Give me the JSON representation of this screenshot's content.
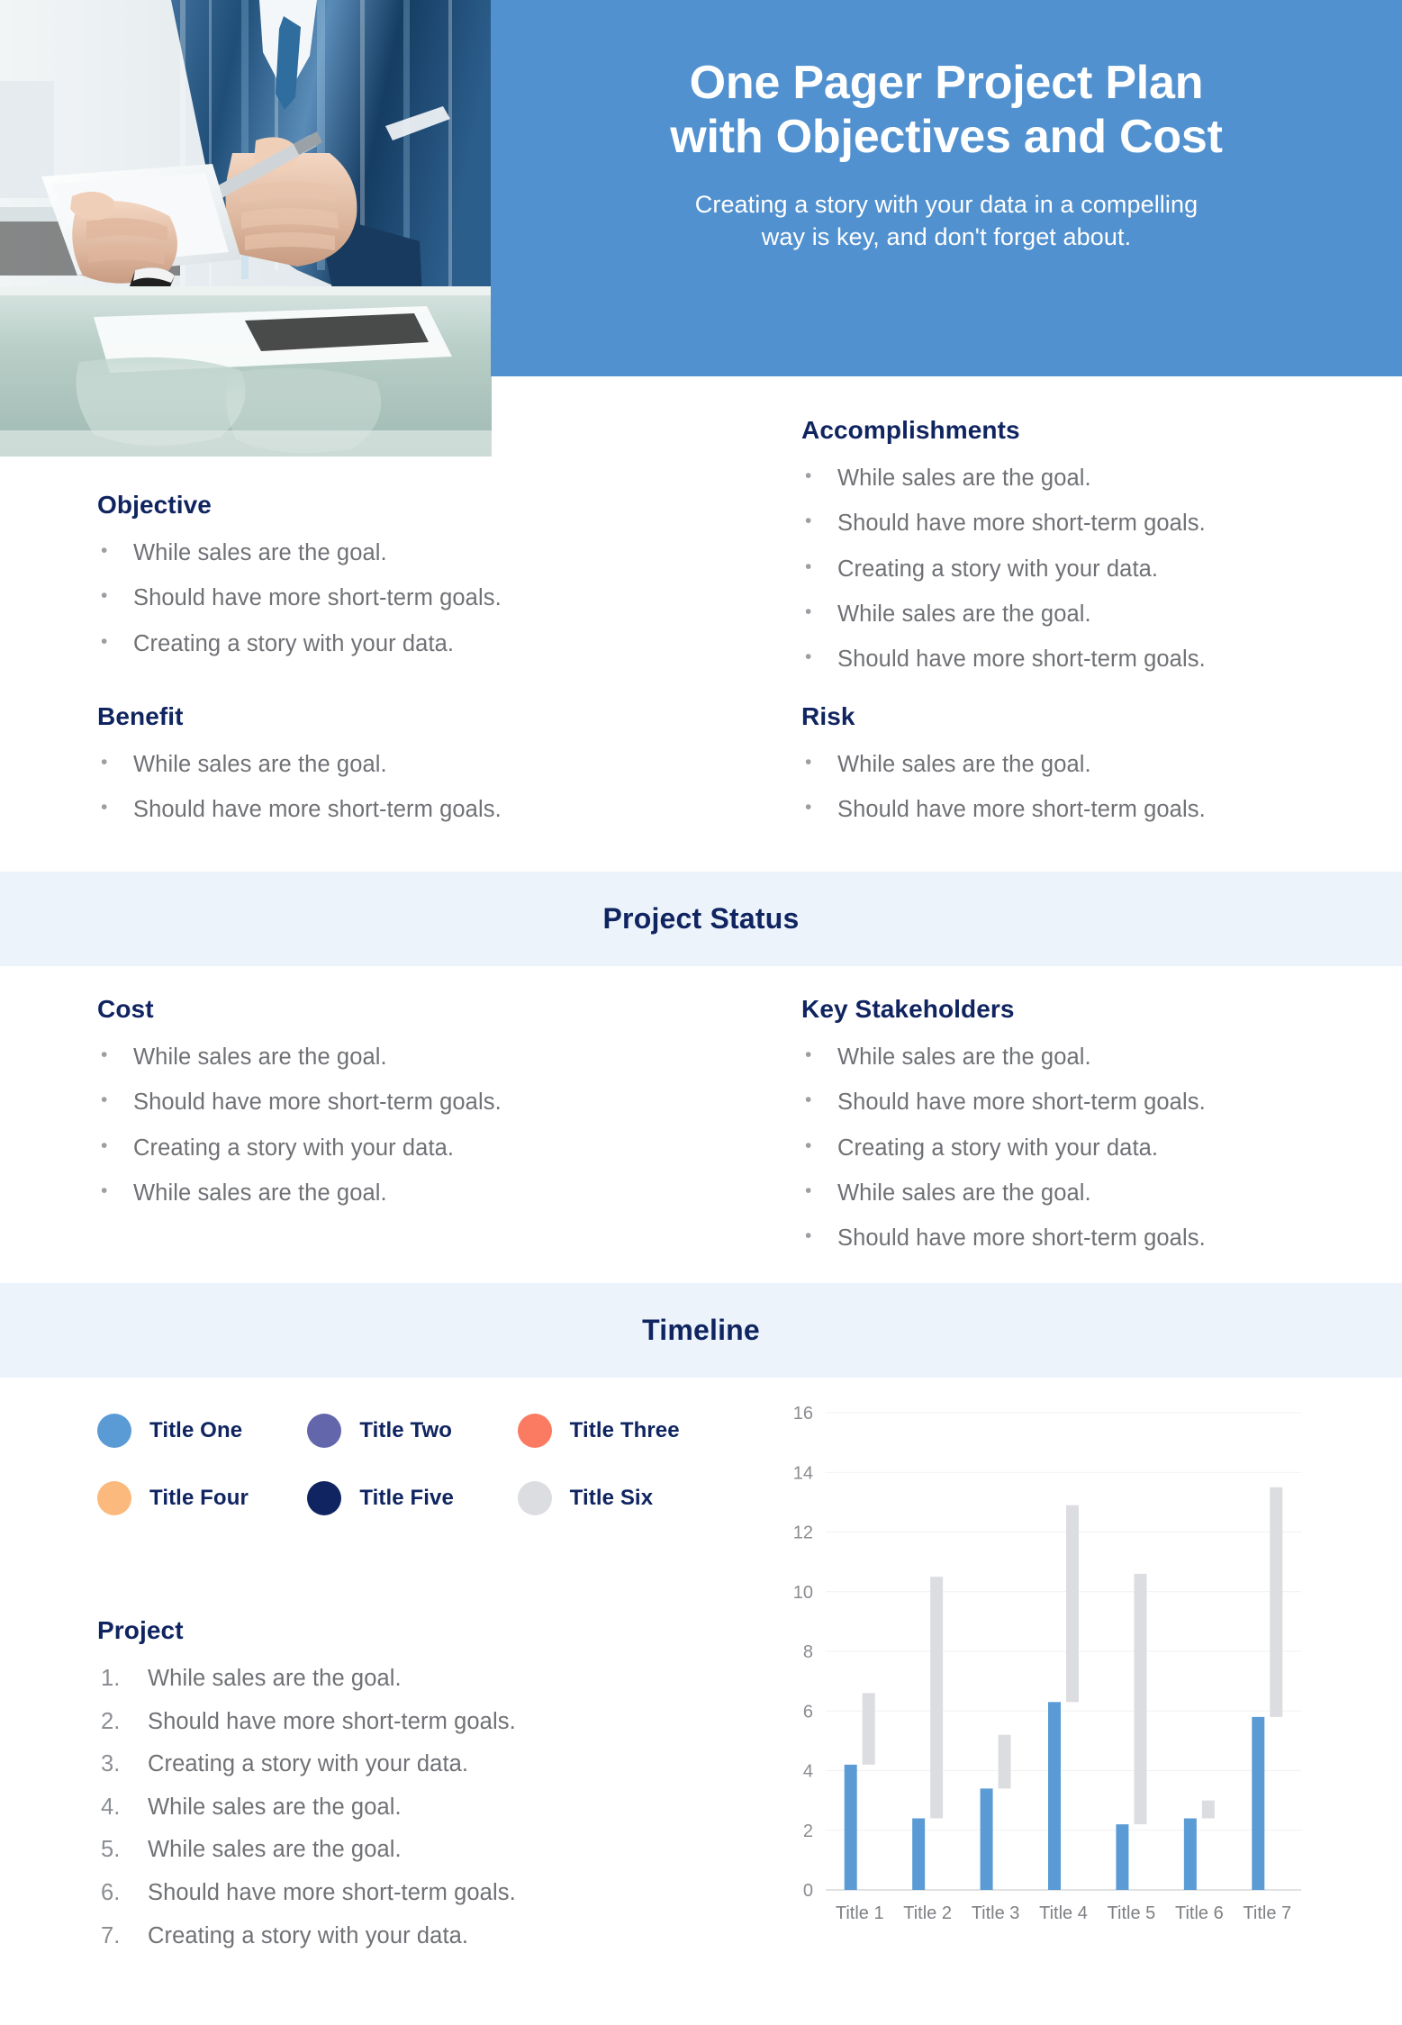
{
  "header": {
    "title_line1": "One Pager Project Plan",
    "title_line2": "with Objectives and Cost",
    "subtitle_line1": "Creating a story with your data in a compelling",
    "subtitle_line2": "way is key, and don't forget about.",
    "bg_color": "#5191cf"
  },
  "colors": {
    "heading_navy": "#0f2460",
    "body_gray": "#6f7175",
    "band_bg": "#ecf3fb",
    "accent_blue": "#5191cf"
  },
  "objective": {
    "heading": "Objective",
    "items": [
      "While sales are the goal.",
      "Should have more short-term goals.",
      "Creating a story with your data."
    ]
  },
  "benefit": {
    "heading": "Benefit",
    "items": [
      "While sales are the goal.",
      "Should have more short-term goals."
    ]
  },
  "accomplishments": {
    "heading": "Accomplishments",
    "items": [
      "While sales are the goal.",
      "Should have more short-term goals.",
      "Creating a story with your data.",
      "While sales are the goal.",
      "Should have more short-term goals."
    ]
  },
  "risk": {
    "heading": "Risk",
    "items": [
      "While sales are the goal.",
      "Should have more short-term goals."
    ]
  },
  "project_status_band": {
    "title": "Project Status"
  },
  "cost": {
    "heading": "Cost",
    "items": [
      "While sales are the goal.",
      "Should have more short-term goals.",
      "Creating a story with your data.",
      "While sales are the goal."
    ]
  },
  "stakeholders": {
    "heading": "Key Stakeholders",
    "items": [
      "While sales are the goal.",
      "Should have more short-term goals.",
      "Creating a story with your data.",
      "While sales are the goal.",
      "Should have more short-term goals."
    ]
  },
  "timeline_band": {
    "title": "Timeline"
  },
  "legend": {
    "items": [
      {
        "label": "Title One",
        "color": "#5b9bd5"
      },
      {
        "label": "Title Two",
        "color": "#6366ab"
      },
      {
        "label": "Title Three",
        "color": "#fa7a62"
      },
      {
        "label": "Title Four",
        "color": "#fcb97d"
      },
      {
        "label": "Title Five",
        "color": "#0f2460"
      },
      {
        "label": "Title Six",
        "color": "#dcdde0"
      }
    ]
  },
  "project": {
    "heading": "Project",
    "items": [
      "While sales are the goal.",
      "Should have more short-term goals.",
      "Creating a story with your data.",
      "While sales are the goal.",
      "While sales are the goal.",
      "Should have more short-term goals.",
      "Creating a story with your data."
    ]
  },
  "chart_data": {
    "type": "bar",
    "title": "",
    "xlabel": "",
    "ylabel": "",
    "ylim": [
      0,
      16
    ],
    "yticks": [
      0,
      2,
      4,
      6,
      8,
      10,
      12,
      14,
      16
    ],
    "grid": true,
    "legend_position": "left-external",
    "categories": [
      "Title 1",
      "Title 2",
      "Title 3",
      "Title 4",
      "Title 5",
      "Title 6",
      "Title 7"
    ],
    "series": [
      {
        "name": "Title One",
        "color": "#5b9bd5",
        "kind": "column-from-zero",
        "values": [
          4.2,
          2.4,
          3.4,
          6.3,
          2.2,
          2.4,
          5.8
        ]
      },
      {
        "name": "Title Six",
        "color": "#dcdde0",
        "kind": "floating-range",
        "ranges": [
          {
            "start": 4.2,
            "end": 6.6
          },
          {
            "start": 2.4,
            "end": 10.5
          },
          {
            "start": 3.4,
            "end": 5.2
          },
          {
            "start": 6.3,
            "end": 12.9
          },
          {
            "start": 2.2,
            "end": 10.6
          },
          {
            "start": 2.4,
            "end": 3.0
          },
          {
            "start": 5.8,
            "end": 13.5
          }
        ]
      }
    ]
  }
}
